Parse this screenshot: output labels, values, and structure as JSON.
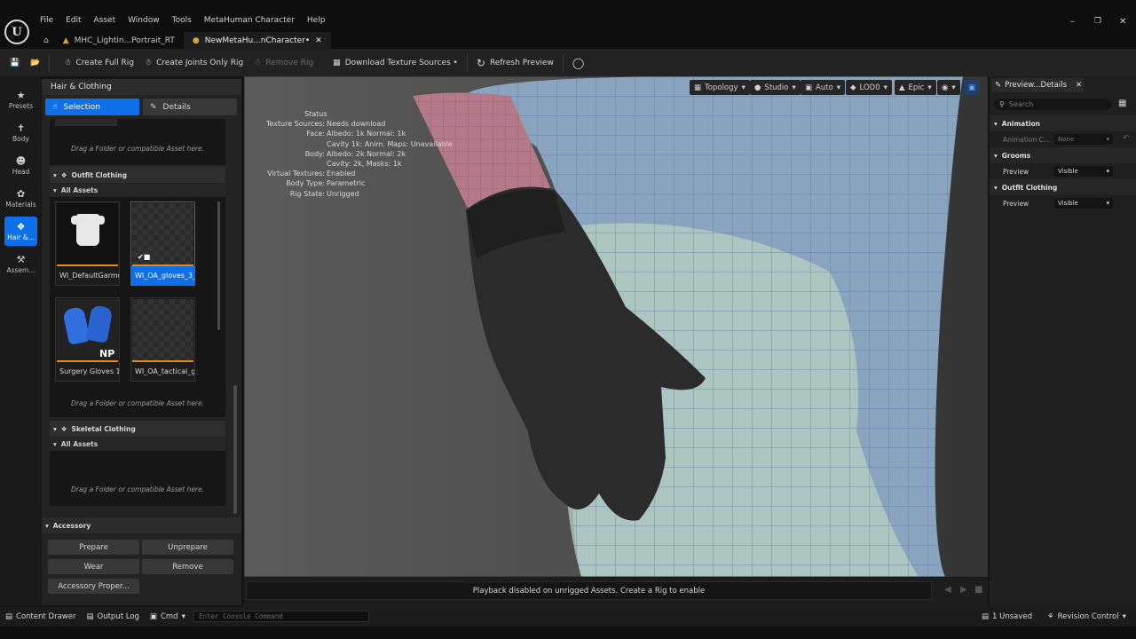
{
  "menu": [
    "File",
    "Edit",
    "Asset",
    "Window",
    "Tools",
    "MetaHuman Character",
    "Help"
  ],
  "tabs": [
    {
      "label": "MHC_Lightin...Portrait_RT"
    },
    {
      "label": "NewMetaHu...nCharacter•"
    }
  ],
  "toolbar": {
    "create_full_rig": "Create Full Rig",
    "create_joints": "Create Joints Only Rig",
    "remove_rig": "Remove Rig",
    "download": "Download Texture Sources •",
    "refresh": "Refresh Preview"
  },
  "rail": [
    "Presets",
    "Body",
    "Head",
    "Materials",
    "Hair &...",
    "Assem..."
  ],
  "left_panel": {
    "title": "Hair & Clothing",
    "tab_selection": "Selection",
    "tab_details": "Details",
    "drop_hint": "Drag a Folder or compatible Asset here.",
    "outfit_section": "Outfit Clothing",
    "all_assets": "All Assets",
    "assets": [
      "WI_DefaultGarment",
      "WI_OA_gloves_3_...",
      "Surgery Gloves 1...",
      "WI_OA_tactical_g..."
    ],
    "np_badge": "NP",
    "skeletal_section": "Skeletal Clothing",
    "accessory_section": "Accessory",
    "buttons": {
      "prepare": "Prepare",
      "unprepare": "Unprepare",
      "wear": "Wear",
      "remove": "Remove",
      "props": "Accessory Proper..."
    }
  },
  "viewport_toolbar": [
    "Topology",
    "Studio",
    "Auto",
    "LOD0",
    "Epic"
  ],
  "status": {
    "header": "Status",
    "rows": [
      {
        "k": "Texture Sources:",
        "v": "Needs download"
      },
      {
        "k": "Face:",
        "v": "Albedo: 1k Normal: 1k"
      },
      {
        "k": "",
        "v": "Cavity 1k: Anim. Maps: Unavailable"
      },
      {
        "k": "Body:",
        "v": "Albedo: 2k Normal: 2k"
      },
      {
        "k": "",
        "v": "Cavity: 2k, Masks: 1k"
      },
      {
        "k": "Virtual Textures:",
        "v": "Enabled"
      },
      {
        "k": "Body Type:",
        "v": "Parametric"
      },
      {
        "k": "Rig State:",
        "v": "Unrigged"
      }
    ]
  },
  "playback_msg": "Playback disabled on unrigged Assets. Create a Rig to enable",
  "statusbar": {
    "content_drawer": "Content Drawer",
    "output_log": "Output Log",
    "cmd": "Cmd",
    "console_placeholder": "Enter Console Command",
    "unsaved": "1 Unsaved",
    "revision": "Revision Control"
  },
  "right_panel": {
    "tab": "Preview...Details",
    "search_placeholder": "Search",
    "animation": "Animation",
    "animation_row": "Animation C...",
    "animation_value": "None",
    "grooms": "Grooms",
    "preview": "Preview",
    "visible": "Visible",
    "outfit_clothing": "Outfit Clothing"
  }
}
